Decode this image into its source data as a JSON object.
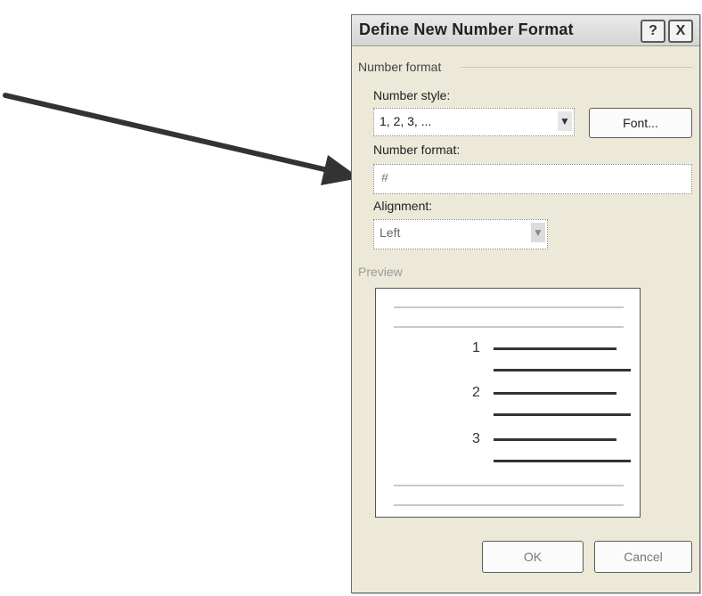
{
  "dialog": {
    "title": "Define New Number Format",
    "help_icon": "?",
    "close_icon": "X",
    "group_number_format": "Number format",
    "number_style": {
      "label": "Number style:",
      "value": "1, 2, 3, ..."
    },
    "font_button": "Font...",
    "number_format": {
      "label": "Number format:",
      "value": "#"
    },
    "alignment": {
      "label": "Alignment:",
      "value": "Left"
    },
    "preview_label": "Preview",
    "preview_numbers": [
      "1",
      "2",
      "3"
    ],
    "ok_button": "OK",
    "cancel_button": "Cancel"
  },
  "icons": {
    "dropdown": "chevron-down-icon"
  }
}
